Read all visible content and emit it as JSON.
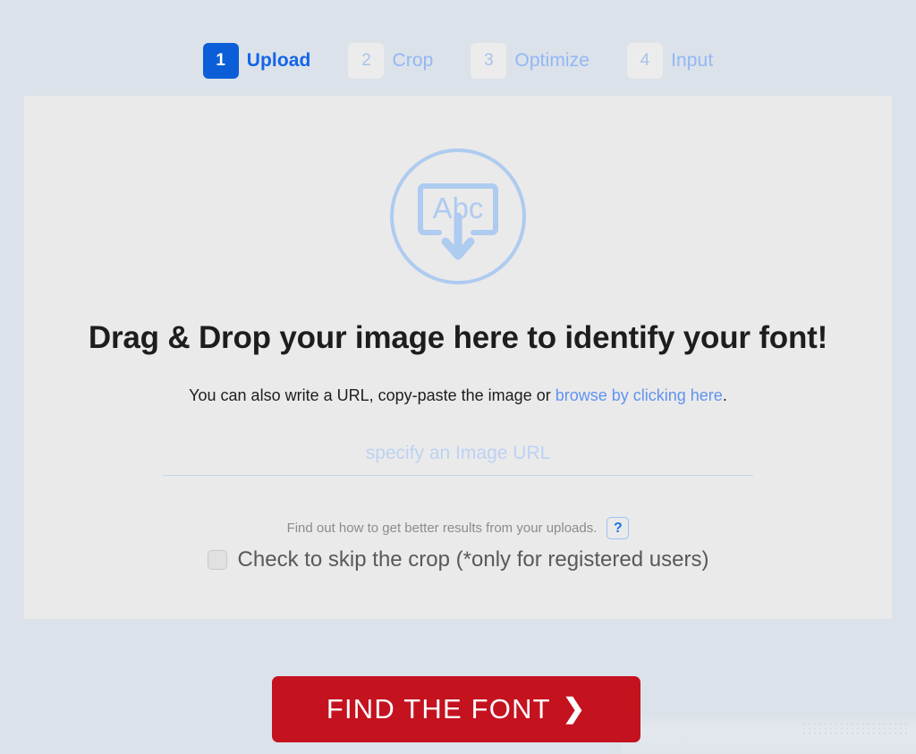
{
  "theme": {
    "page_bg": "#dce2e9",
    "panel_bg": "#ebeaea",
    "accent_blue": "#0b5ed7",
    "link_blue": "#5f93f0",
    "muted_blue": "#93b7f5",
    "cta_red": "#c4121f",
    "icon_blue": "#aecbf0"
  },
  "steps": [
    {
      "number": "1",
      "label": "Upload",
      "active": true
    },
    {
      "number": "2",
      "label": "Crop",
      "active": false
    },
    {
      "number": "3",
      "label": "Optimize",
      "active": false
    },
    {
      "number": "4",
      "label": "Input",
      "active": false
    }
  ],
  "dropzone": {
    "icon_name": "upload-abc-icon",
    "icon_text": "Abc",
    "headline": "Drag & Drop your image here to identify your font!",
    "subline_prefix": "You can also write a URL, copy-paste the image or ",
    "subline_link": "browse by clicking here",
    "subline_suffix": ".",
    "url_input": {
      "placeholder": "specify an Image URL",
      "value": ""
    },
    "hint_text": "Find out how to get better results from your uploads.",
    "help_button_label": "?",
    "skip_crop_label": "Check to skip the crop (*only for registered users)",
    "skip_crop_checked": false
  },
  "cta": {
    "label": "FIND THE FONT",
    "chevron": "❯"
  }
}
